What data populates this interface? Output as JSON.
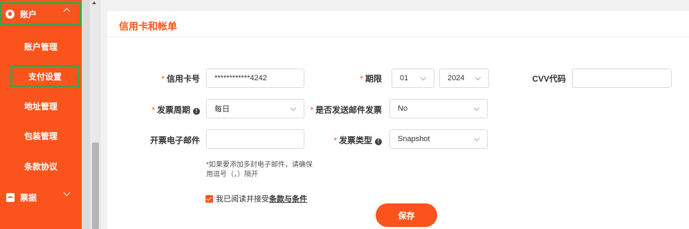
{
  "sidebar": {
    "account": {
      "label": "账户",
      "icon": "user-icon",
      "expanded": true
    },
    "items": [
      {
        "label": "账户管理"
      },
      {
        "label": "支付设置",
        "selected": true
      },
      {
        "label": "地址管理"
      },
      {
        "label": "包装管理"
      },
      {
        "label": "条款协议"
      }
    ],
    "invoices": {
      "label": "票据",
      "icon": "document-icon",
      "expanded": false
    }
  },
  "card": {
    "title": "信用卡和帐单"
  },
  "form": {
    "card_number": {
      "label": "信用卡号",
      "value": "************4242",
      "required": true
    },
    "expiry": {
      "label": "期限",
      "month": "01",
      "year": "2024",
      "required": true
    },
    "cvv": {
      "label": "CVV代码",
      "value": ""
    },
    "invoice_cycle": {
      "label": "发票周期",
      "value": "每日",
      "required": true
    },
    "email_invoice": {
      "label": "是否发送邮件发票",
      "value": "No",
      "required": true
    },
    "invoice_email": {
      "label": "开票电子邮件",
      "value": ""
    },
    "invoice_type": {
      "label": "发票类型",
      "value": "Snapshot",
      "required": true
    },
    "hint": "*如果要添加多封电子邮件，请确保用逗号（，）隔开",
    "agree_prefix": "我已阅读并接受",
    "agree_terms": "条款与条件",
    "agree_checked": true,
    "save_label": "保存"
  },
  "colors": {
    "accent": "#fa541c",
    "highlight": "#43a047"
  }
}
